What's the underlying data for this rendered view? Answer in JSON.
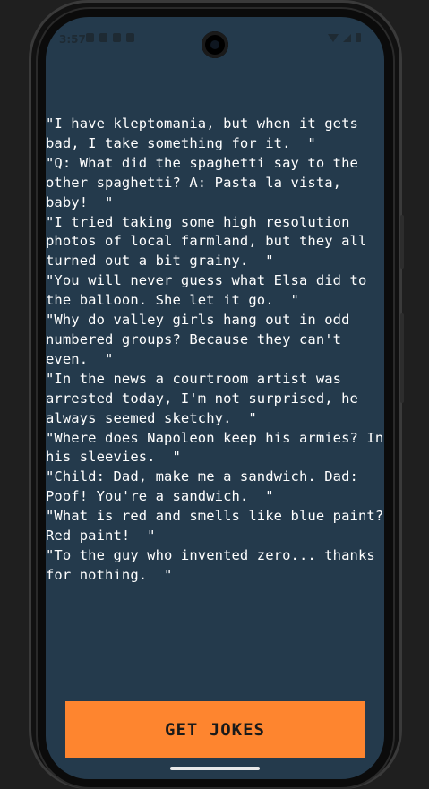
{
  "status_bar": {
    "time": "3:57",
    "left_icons": [
      "do-not-disturb-icon",
      "shield-icon",
      "sim-icon",
      "notification-icon"
    ],
    "right_icons": [
      "wifi-icon",
      "signal-icon",
      "battery-icon"
    ]
  },
  "jokes": [
    "\"I have kleptomania, but when it gets bad, I take something for it.  \"",
    "\"Q: What did the spaghetti say to the other spaghetti? A: Pasta la vista, baby!  \"",
    "\"I tried taking some high resolution photos of local farmland, but they all turned out a bit grainy.  \"",
    "\"You will never guess what Elsa did to the balloon. She let it go.  \"",
    "\"Why do valley girls hang out in odd numbered groups? Because they can't even.  \"",
    "\"In the news a courtroom artist was arrested today, I'm not surprised, he always seemed sketchy.  \"",
    "\"Where does Napoleon keep his armies? In his sleevies.  \"",
    "\"Child: Dad, make me a sandwich. Dad: Poof! You're a sandwich.  \"",
    "\"What is red and smells like blue paint? Red paint!  \"",
    "\"To the guy who invented zero... thanks for nothing.  \""
  ],
  "button": {
    "label": "GET JOKES"
  },
  "colors": {
    "screen_background": "#243a4c",
    "button_background": "#fe852f",
    "joke_text": "#ffffff"
  }
}
